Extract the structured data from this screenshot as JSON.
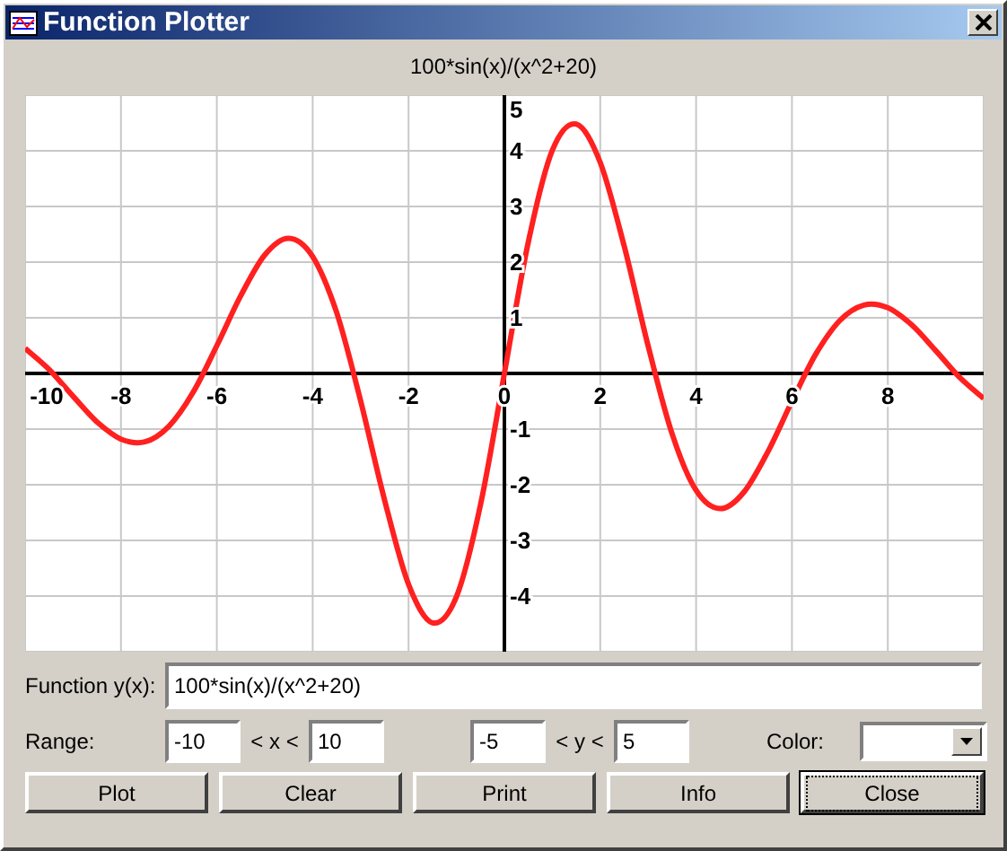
{
  "window": {
    "title": "Function Plotter"
  },
  "plot": {
    "chart_data": {
      "type": "line",
      "title": "100*sin(x)/(x^2+20)",
      "xlim": [
        -10,
        10
      ],
      "ylim": [
        -5,
        5
      ],
      "xticks": [
        -10,
        -8,
        -6,
        -4,
        -2,
        0,
        2,
        4,
        6,
        8
      ],
      "yticks": [
        -4,
        -3,
        -2,
        -1,
        1,
        2,
        3,
        4,
        5
      ],
      "grid": true,
      "x": [
        -10,
        -9.5,
        -9,
        -8.5,
        -8,
        -7.5,
        -7,
        -6.5,
        -6,
        -5.5,
        -5,
        -4.5,
        -4,
        -3.5,
        -3,
        -2.5,
        -2,
        -1.5,
        -1,
        -0.5,
        0,
        0.5,
        1,
        1.5,
        2,
        2.5,
        3,
        3.5,
        4,
        4.5,
        5,
        5.5,
        6,
        6.5,
        7,
        7.5,
        8,
        8.5,
        9,
        9.5,
        10
      ],
      "series": [
        {
          "color": "#ff2020",
          "values": [
            0.45,
            0.07,
            -0.41,
            -0.87,
            -1.18,
            -1.23,
            -0.95,
            -0.35,
            0.5,
            1.4,
            2.13,
            2.43,
            2.1,
            1.09,
            -0.49,
            -2.28,
            -3.79,
            -4.48,
            -4.01,
            -2.37,
            0,
            2.37,
            4.01,
            4.48,
            3.79,
            2.28,
            0.49,
            -1.09,
            -2.1,
            -2.43,
            -2.13,
            -1.4,
            -0.5,
            0.35,
            0.95,
            1.23,
            1.18,
            0.87,
            0.41,
            -0.07,
            -0.45
          ]
        }
      ]
    }
  },
  "function": {
    "label": "Function y(x):",
    "value": "100*sin(x)/(x^2+20)"
  },
  "range": {
    "label": "Range:",
    "x_min": "-10",
    "x_sep": "< x <",
    "x_max": "10",
    "y_min": "-5",
    "y_sep": "< y <",
    "y_max": "5",
    "color_label": "Color:"
  },
  "buttons": [
    {
      "label": "Plot",
      "focused": false
    },
    {
      "label": "Clear",
      "focused": false
    },
    {
      "label": "Print",
      "focused": false
    },
    {
      "label": "Info",
      "focused": false
    },
    {
      "label": "Close",
      "focused": true
    }
  ]
}
